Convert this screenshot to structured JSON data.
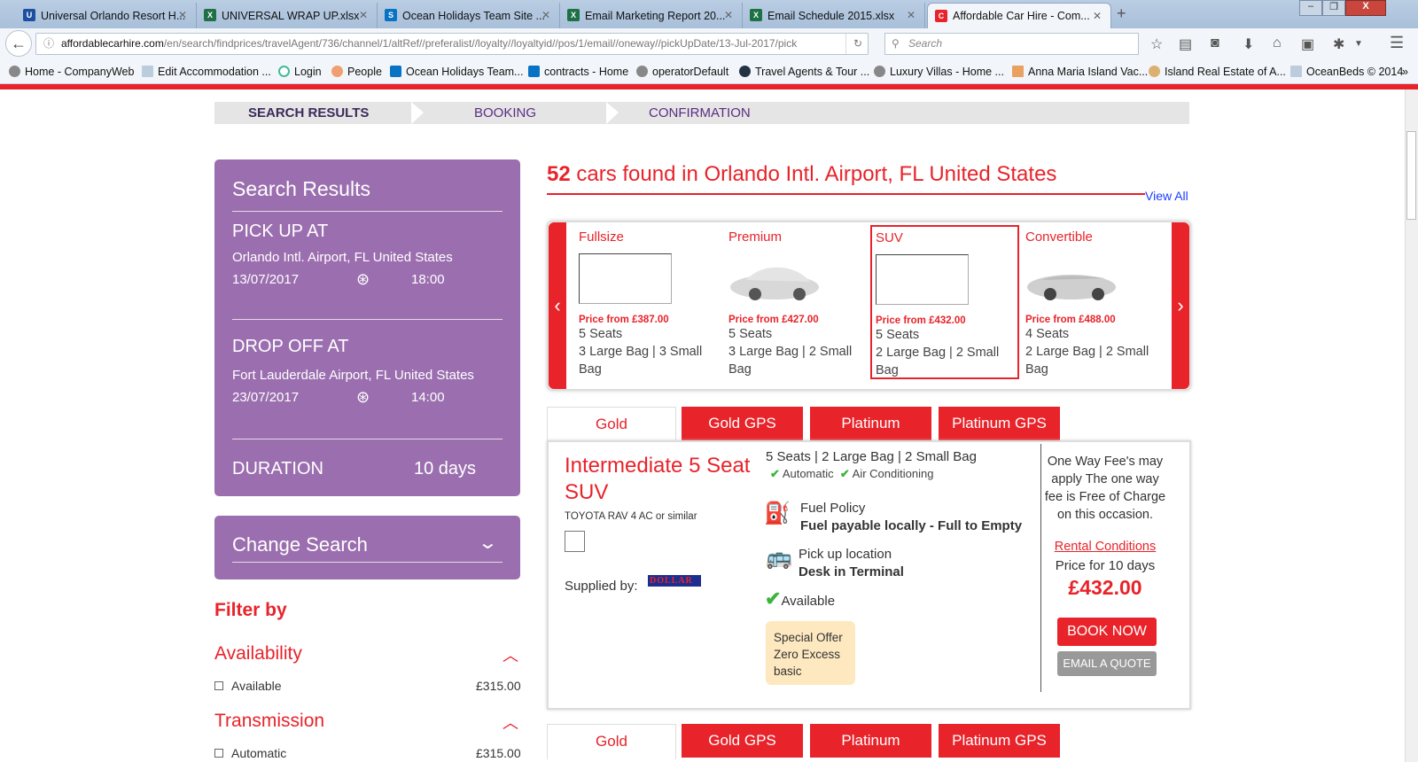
{
  "browser": {
    "tabs": [
      {
        "title": "Universal Orlando Resort H...",
        "icon": "universal-icon"
      },
      {
        "title": "UNIVERSAL WRAP UP.xlsx",
        "icon": "excel-icon"
      },
      {
        "title": "Ocean Holidays Team Site ...",
        "icon": "sharepoint-icon"
      },
      {
        "title": "Email Marketing Report 20...",
        "icon": "excel-icon"
      },
      {
        "title": "Email Schedule 2015.xlsx",
        "icon": "excel-icon"
      },
      {
        "title": "Affordable Car Hire - Com...",
        "icon": "car-hire-icon"
      }
    ],
    "url_host": "affordablecarhire.com",
    "url_path": "/en/search/findprices/travelAgent/736/channel/1/altRef//preferalist//loyalty//loyaltyid//pos/1/email//oneway//pickUpDate/13-Jul-2017/pick",
    "search_placeholder": "Search",
    "bookmarks": [
      "Home - CompanyWeb",
      "Edit Accommodation ...",
      "Login",
      "People",
      "Ocean Holidays Team...",
      "contracts - Home",
      "operatorDefault",
      "Travel Agents & Tour ...",
      "Luxury Villas - Home ...",
      "Anna Maria Island Vac...",
      "Island Real Estate of A...",
      "OceanBeds © 2014"
    ]
  },
  "steps": [
    "SEARCH RESULTS",
    "BOOKING",
    "CONFIRMATION"
  ],
  "sidebar": {
    "title": "Search Results",
    "pickup_label": "PICK UP AT",
    "pickup_location": "Orlando Intl. Airport, FL United States",
    "pickup_date": "13/07/2017",
    "pickup_time": "18:00",
    "dropoff_label": "DROP OFF AT",
    "dropoff_location": "Fort Lauderdale Airport, FL United States",
    "dropoff_date": "23/07/2017",
    "dropoff_time": "14:00",
    "duration_label": "DURATION",
    "duration_value": "10 days",
    "change_search": "Change Search",
    "filter_by": "Filter by",
    "filters": [
      {
        "title": "Availability",
        "option": "Available",
        "price": "£315.00"
      },
      {
        "title": "Transmission",
        "option": "Automatic",
        "price": "£315.00"
      }
    ]
  },
  "headline": {
    "count": "52",
    "text": " cars found in Orlando Intl. Airport, FL United States",
    "view_all": "View All"
  },
  "categories": [
    {
      "name": "Fullsize",
      "price": "Price from £387.00",
      "seats": "5 Seats",
      "bags": "3 Large Bag | 3 Small Bag"
    },
    {
      "name": "Premium",
      "price": "Price from £427.00",
      "seats": "5 Seats",
      "bags": "3 Large Bag | 2 Small Bag"
    },
    {
      "name": "SUV",
      "price": "Price from £432.00",
      "seats": "5 Seats",
      "bags": "2 Large Bag | 2 Small Bag"
    },
    {
      "name": "Convertible",
      "price": "Price from £488.00",
      "seats": "4 Seats",
      "bags": "2 Large Bag | 2 Small Bag"
    }
  ],
  "rate_tabs": [
    "Gold",
    "Gold GPS",
    "Platinum",
    "Platinum GPS"
  ],
  "offer": {
    "title": "Intermediate 5 Seat SUV",
    "model": "TOYOTA RAV 4 AC or similar",
    "supplied_by": "Supplied by:",
    "supplier": "DOLLAR",
    "specs": "5 Seats | 2 Large Bag | 2 Small Bag",
    "feature1": "Automatic",
    "feature2": "Air Conditioning",
    "fuel_label": "Fuel Policy",
    "fuel_value": "Fuel payable locally - Full to Empty",
    "pickup_label": "Pick up location",
    "pickup_value": "Desk in Terminal",
    "availability": "Available",
    "special1": "Special Offer",
    "special2": "Zero Excess",
    "special3": "basic",
    "one_way_note": "One Way Fee's may apply The one way fee is Free of Charge on this occasion.",
    "rental_conditions": "Rental Conditions",
    "price_for": "Price for 10 days",
    "price": "£432.00",
    "book_now": "BOOK NOW",
    "email_quote": "EMAIL A QUOTE"
  },
  "colors": {
    "brand_red": "#e8232a",
    "panel_purple": "#9b6faf"
  }
}
